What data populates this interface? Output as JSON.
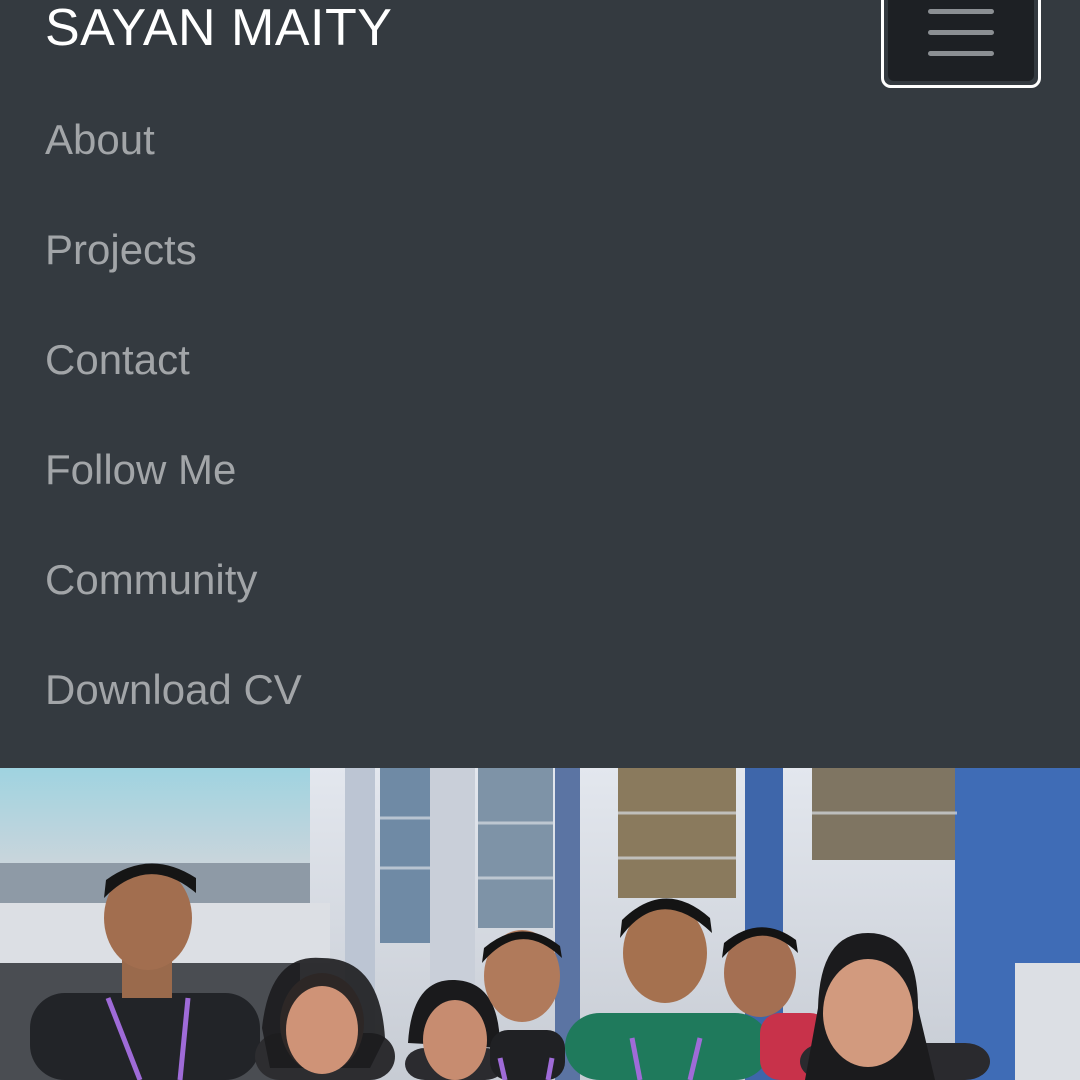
{
  "navbar": {
    "brand": "SAYAN MAITY",
    "toggler_icon": "hamburger-menu-icon",
    "items": [
      {
        "label": "About"
      },
      {
        "label": "Projects"
      },
      {
        "label": "Contact"
      },
      {
        "label": "Follow Me"
      },
      {
        "label": "Community"
      },
      {
        "label": "Download CV"
      }
    ]
  },
  "colors": {
    "navbar_bg": "#343a40",
    "brand_text": "#ffffff",
    "nav_link": "#a2a5a8"
  },
  "hero": {
    "description": "group-photo"
  }
}
